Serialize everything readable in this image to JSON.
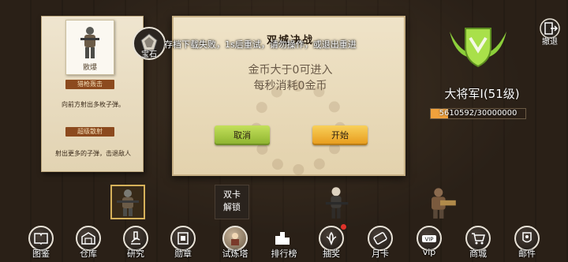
{
  "skill_card": {
    "character_name": "散爆",
    "skill1_name": "猎枪轰击",
    "skill1_desc": "向前方射出多枚子弹。",
    "skill2_name": "超级散射",
    "skill2_desc": "射出更多的子弹，击退敌人"
  },
  "dialog": {
    "title": "双城决战",
    "line1": "金币大于0可进入",
    "line2": "每秒消耗0金币",
    "cancel_label": "取消",
    "start_label": "开始"
  },
  "toast": "存档下载失败，1s后重试，请勿操作，或退出重进",
  "treasure_label": "宝石",
  "rank": {
    "title": "大将军I(51级)",
    "xp_text": "5610592/30000000",
    "xp_fraction": 0.187
  },
  "retreat_label": "撤退",
  "locked_slot": {
    "line1": "双卡",
    "line2": "解锁"
  },
  "nav": [
    {
      "label": "图鉴",
      "icon": "book-icon"
    },
    {
      "label": "仓库",
      "icon": "warehouse-icon"
    },
    {
      "label": "研究",
      "icon": "microscope-icon"
    },
    {
      "label": "勋章",
      "icon": "medal-icon"
    },
    {
      "label": "试炼塔",
      "icon": "tower-icon"
    },
    {
      "label": "排行榜",
      "icon": "podium-icon"
    },
    {
      "label": "抽奖",
      "icon": "gift-icon"
    },
    {
      "label": "月卡",
      "icon": "ticket-icon"
    },
    {
      "label": "vip",
      "icon": "vip-icon"
    },
    {
      "label": "商城",
      "icon": "cart-icon"
    },
    {
      "label": "邮件",
      "icon": "mail-icon"
    }
  ],
  "colors": {
    "accent_orange": "#f0a13c",
    "button_green": "#8cb22e",
    "button_yellow": "#e79a1a",
    "skill_tag": "#8c4a1e"
  }
}
